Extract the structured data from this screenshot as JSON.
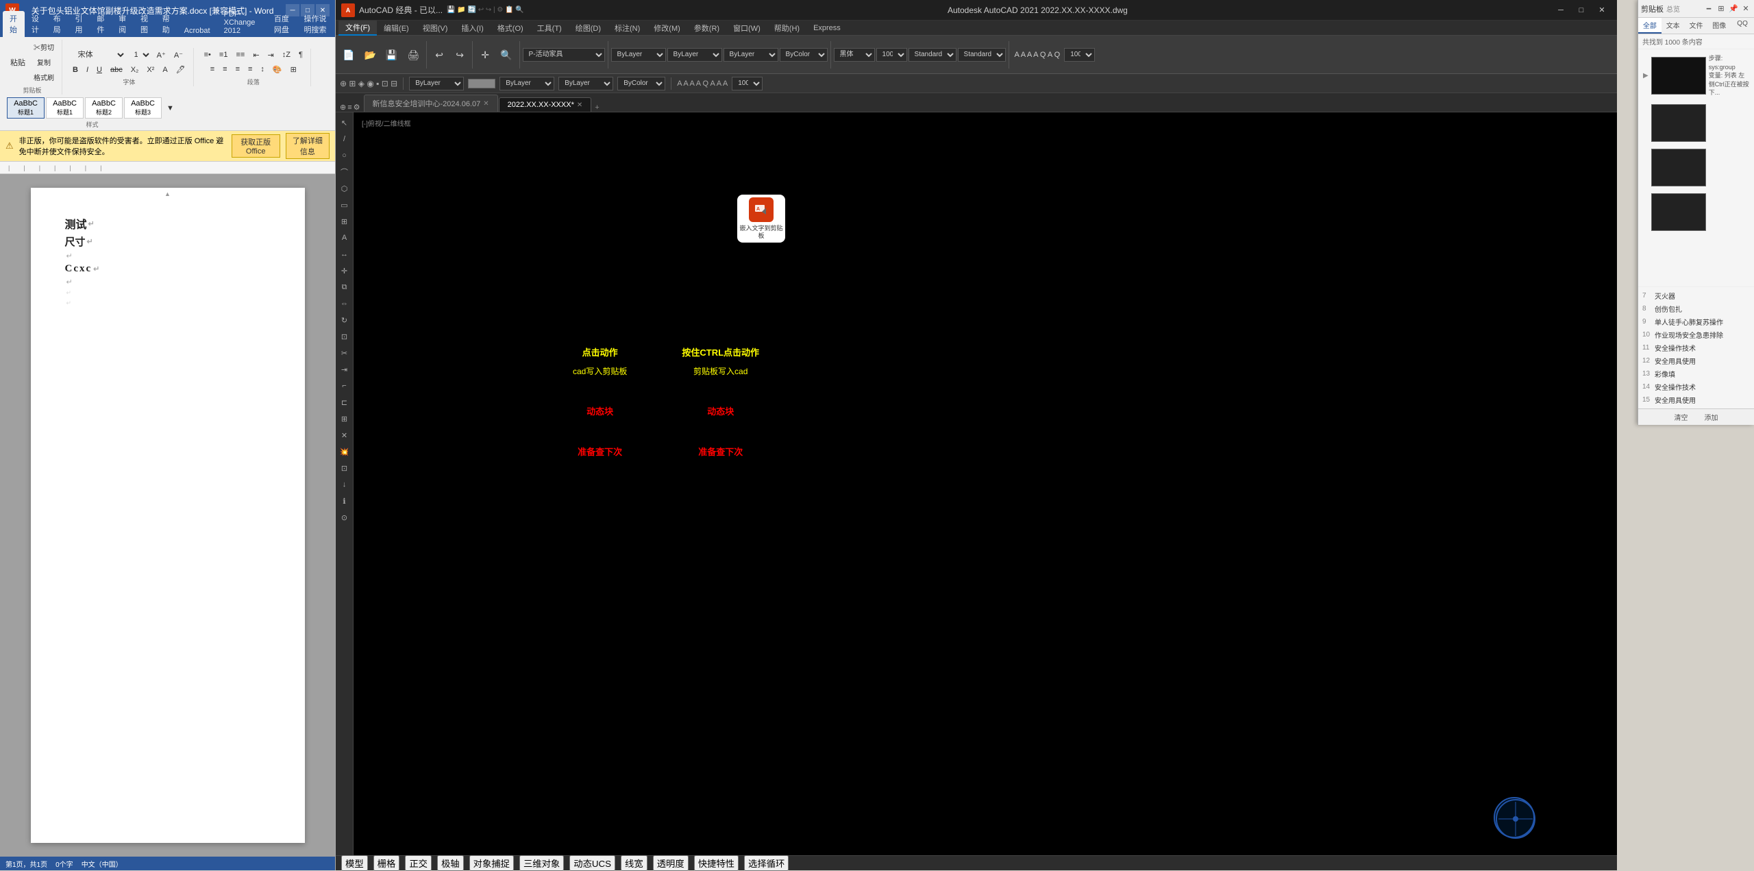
{
  "word": {
    "titlebar": {
      "title": "关于包头铝业文体馆副楼升级改造需求方案.docx [兼容模式] - Word",
      "app": "Word"
    },
    "ribbon_tabs": [
      "设计",
      "布局",
      "引用",
      "邮件",
      "审阅",
      "视图",
      "帮助",
      "Acrobat",
      "PDF-XChange 2012",
      "百度网盘",
      "操作说明搜索"
    ],
    "active_tab": "开始",
    "ribbon_groups": {
      "font_label": "字体",
      "para_label": "段落",
      "style_label": "样式"
    },
    "styles": [
      "AaBbC 标题1",
      "AaBbC 标题2",
      "AaBbC 标题3"
    ],
    "warning": {
      "text": "非正版，你可能是盗版软件的受害者。立即通过正版 Office 避免中断并使文件保持安全。",
      "btn1": "获取正版 Office",
      "btn2": "了解详细信息"
    },
    "document": {
      "lines": [
        {
          "text": "测试",
          "type": "heading1",
          "pilcrow": true
        },
        {
          "text": "尺寸",
          "type": "heading2",
          "pilcrow": true
        },
        {
          "text": "",
          "type": "empty",
          "pilcrow": true
        },
        {
          "text": "Ccxc",
          "type": "special",
          "pilcrow": true
        },
        {
          "text": "",
          "type": "empty2",
          "pilcrow": true
        },
        {
          "text": "",
          "type": "small1"
        },
        {
          "text": "",
          "type": "small2"
        }
      ]
    },
    "statusbar": {
      "page": "第1页，共1页",
      "words": "0个字",
      "language": "中文（中国）"
    }
  },
  "cad": {
    "titlebar": {
      "title": "Autodesk AutoCAD 2021  2022.XX.XX-XXXX.dwg",
      "app_title": "AutoCAD 经典 - 已以..."
    },
    "ribbon_tabs": [
      "文件(F)",
      "编辑(E)",
      "视图(V)",
      "插入(I)",
      "格式(O)",
      "工具(T)",
      "绘图(D)",
      "标注(N)",
      "修改(M)",
      "参数(R)",
      "窗口(W)",
      "帮助(H)",
      "Express"
    ],
    "active_tab": "文件(F)",
    "toolbar": {
      "layer_label": "P-活动家具",
      "layer_name": "ByLayer",
      "color": "ByLayer",
      "linetype": "ByLayer",
      "lineweight": "ByColor",
      "font": "黑体",
      "font_size": "100",
      "style1": "Standard",
      "style2": "Standard",
      "scale": "100"
    },
    "doc_tabs": [
      {
        "label": "新信息安全培训中心-2024.06.07",
        "active": false,
        "closeable": true
      },
      {
        "label": "2022.XX.XX-XXXX*",
        "active": true,
        "closeable": true
      }
    ],
    "breadcrumb": "[-]俯视/二维线框",
    "canvas": {
      "popup_icon": {
        "label": "嵌入文字到剪贴板"
      },
      "tooltip": {
        "col1": {
          "title": "点击动作",
          "subtitle": "cad写入剪贴板",
          "action": "动态块",
          "action2": "准备查下次"
        },
        "col2": {
          "title": "按住CTRL点击动作",
          "subtitle": "剪贴板写入cad",
          "action": "动态块",
          "action2": "准备查下次"
        }
      }
    },
    "statusbar": {
      "items": [
        "模型",
        "栅格",
        "正交",
        "极轴",
        "对象捕捉",
        "三维对象",
        "动态UCS",
        "线宽",
        "透明度",
        "快捷特性",
        "选择循环"
      ]
    }
  },
  "clipboard": {
    "title": "剪贴板",
    "filter_tabs": [
      "全部",
      "文本",
      "文件",
      "图像",
      "QQ"
    ],
    "active_filter": "全部",
    "count": "共找到 1000 条内容",
    "items": [
      {
        "type": "image",
        "has_arrow": true,
        "info": "步骤: sys:group\n变量: 列表 左侧Ctrl正在被按下..."
      },
      {
        "type": "image_dark"
      },
      {
        "type": "image_dark2"
      },
      {
        "type": "image_dark3"
      }
    ],
    "text_items": [
      {
        "num": "7",
        "text": "灭火器"
      },
      {
        "num": "8",
        "text": "创伤包扎"
      },
      {
        "num": "9",
        "text": "单人徒手心肺复苏操作"
      },
      {
        "num": "10",
        "text": "作业现场安全急患排除"
      },
      {
        "num": "11",
        "text": "安全操作技术"
      },
      {
        "num": "12",
        "text": "安全用具使用"
      },
      {
        "num": "13",
        "text": "彩像填"
      },
      {
        "num": "14",
        "text": "安全操作技术"
      },
      {
        "num": "15",
        "text": "安全用具使用"
      }
    ],
    "footer": {
      "clear_label": "清空",
      "add_label": "添加"
    }
  }
}
